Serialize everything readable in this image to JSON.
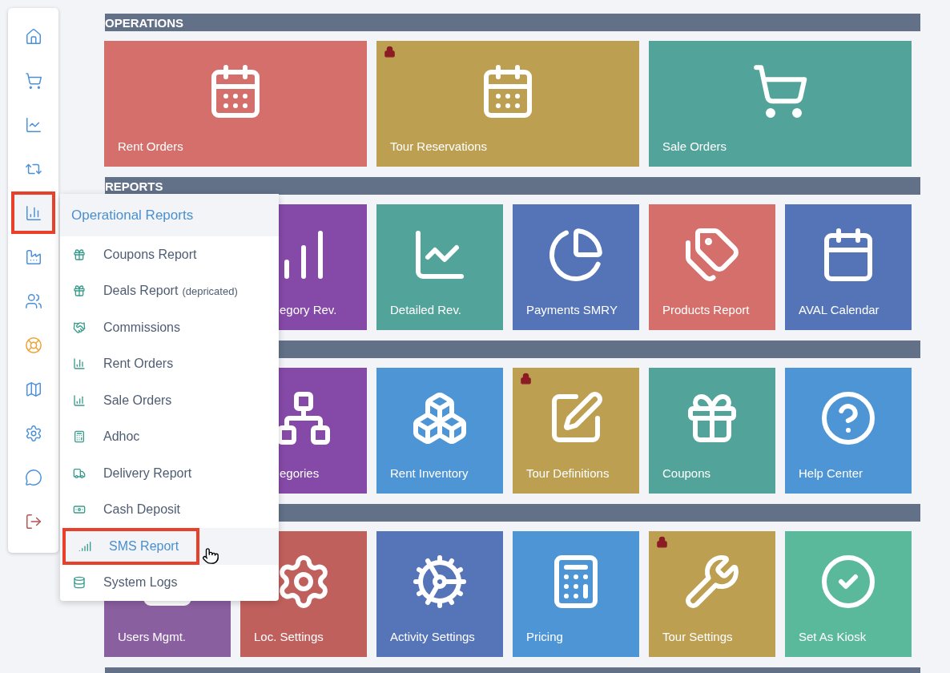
{
  "sidebar": {
    "items": [
      {
        "selected": false
      },
      {
        "selected": false
      },
      {
        "selected": false
      },
      {
        "selected": false
      },
      {
        "selected": true
      },
      {
        "selected": false
      },
      {
        "selected": false
      },
      {
        "selected": false
      },
      {
        "selected": false
      },
      {
        "selected": false
      },
      {
        "selected": false
      },
      {
        "selected": false
      }
    ]
  },
  "sections": [
    {
      "kind": "wide",
      "title": "OPERATIONS",
      "tiles": [
        {
          "label": "Rent Orders",
          "color": "#d56f6b",
          "locked": false,
          "cut": false
        },
        {
          "label": "Tour Reservations",
          "color": "#bd9f52",
          "locked": true,
          "cut": false
        },
        {
          "label": "Sale Orders",
          "color": "#52a39a",
          "locked": false,
          "cut": false
        }
      ]
    },
    {
      "kind": "regular",
      "title": "REPORTS",
      "tiles": [
        {
          "label": "egory Rev.",
          "color": "#8549a7",
          "cut": true
        },
        {
          "label": "Detailed Rev.",
          "color": "#52a39a",
          "locked": false,
          "cut": false
        },
        {
          "label": "Payments SMRY",
          "color": "#5574b8",
          "locked": false,
          "cut": false
        },
        {
          "label": "Products Report",
          "color": "#d56f6b",
          "locked": false,
          "cut": false
        },
        {
          "label": "AVAL Calendar",
          "color": "#5574b8",
          "locked": false,
          "cut": false
        }
      ]
    },
    {
      "kind": "regular",
      "tiles": [
        {
          "label": "egories",
          "color": "#8549a7",
          "cut": true
        },
        {
          "label": "Rent Inventory",
          "color": "#4e95d5",
          "locked": false,
          "cut": false
        },
        {
          "label": "Tour Definitions",
          "color": "#bd9f52",
          "locked": true,
          "cut": false
        },
        {
          "label": "Coupons",
          "color": "#52a39a",
          "locked": false,
          "cut": false
        },
        {
          "label": "Help Center",
          "color": "#4e95d5",
          "locked": false,
          "cut": false
        }
      ]
    },
    {
      "kind": "regular",
      "tiles": [
        {
          "label": "Users Mgmt.",
          "color": "#8a5fa0",
          "cut": false
        },
        {
          "label": "Loc. Settings",
          "color": "#c0605d",
          "cut": false
        },
        {
          "label": "Activity Settings",
          "color": "#5575b8",
          "locked": false,
          "cut": false
        },
        {
          "label": "Pricing",
          "color": "#4e95d5",
          "locked": false,
          "cut": false
        },
        {
          "label": "Tour Settings",
          "color": "#bd9f52",
          "locked": true,
          "cut": false
        },
        {
          "label": "Set As Kiosk",
          "color": "#5ab89b",
          "locked": false,
          "cut": false
        }
      ]
    },
    {
      "kind": "regular"
    }
  ],
  "menu": {
    "title": "Operational Reports",
    "items": [
      {
        "label": "Coupons Report",
        "selected": false
      },
      {
        "label": "Deals Report",
        "note": "(depricated)",
        "selected": false
      },
      {
        "label": "Commissions",
        "selected": false
      },
      {
        "label": "Rent Orders",
        "selected": false
      },
      {
        "label": "Sale Orders",
        "selected": false
      },
      {
        "label": "Adhoc",
        "selected": false
      },
      {
        "label": "Delivery Report",
        "selected": false
      },
      {
        "label": "Cash Deposit",
        "selected": false
      },
      {
        "label": "SMS Report",
        "selected": true
      },
      {
        "label": "System Logs",
        "selected": false
      }
    ]
  }
}
